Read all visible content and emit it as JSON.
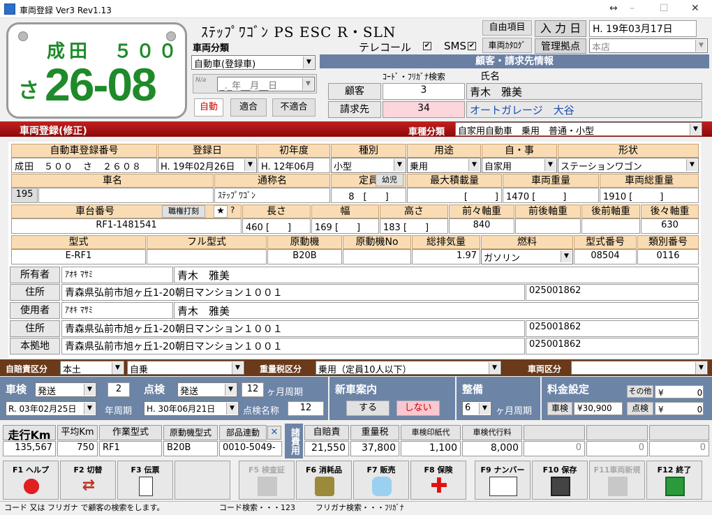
{
  "window": {
    "title": "車両登録 Ver3 Rev1.13",
    "controls": {
      "restore": "↔",
      "minimize": "–",
      "maximize": "☐",
      "close": "✕"
    }
  },
  "plate": {
    "region": "成田　５００",
    "kana": "さ",
    "number": "26-08"
  },
  "car_name": "ｽﾃｯﾌﾟﾜｺﾞﾝ PS ESC R・SLN",
  "top_buttons": {
    "free_item": "自由項目",
    "input_date_label": "入 力 日",
    "input_date": "H. 19年03月17日",
    "car_catalog": "車両ｶﾀﾛｸﾞ",
    "mgmt_base_label": "管理拠点",
    "mgmt_base": "本店"
  },
  "vehicle_class": {
    "label": "車両分類",
    "value": "自動車(登録車)",
    "date_placeholder": "_._年__月__日",
    "buttons": [
      "自動",
      "適合",
      "不適合"
    ]
  },
  "options": {
    "telecall": "テレコール",
    "telecall_mark": "✔",
    "sms": "SMS",
    "sms_mark": "✔"
  },
  "customer": {
    "header": "顧客・請求先情報",
    "col_code": "ｺｰﾄﾞ・ﾌﾘｶﾞﾅ検索",
    "col_name": "氏名",
    "rows": [
      {
        "label": "顧客",
        "code": "3",
        "name": "青木　雅美"
      },
      {
        "label": "請求先",
        "code": "34",
        "name": "オートガレージ　大谷"
      }
    ]
  },
  "section": {
    "title": "車両登録(修正)",
    "type_label": "車種分類",
    "type_value": "自家用自動車　乗用　普通・小型"
  },
  "row1": {
    "headers": [
      "自動車登録番号",
      "登録日",
      "初年度",
      "種別",
      "用途",
      "自・事",
      "形状"
    ],
    "values": [
      "成田　５００　さ　２６０８",
      "H. 19年02月26日",
      "H. 12年06月",
      "小型",
      "乗用",
      "自家用",
      "ステーションワゴン"
    ]
  },
  "row2": {
    "headers": [
      "車名",
      "通称名",
      "定員",
      "最大積載量",
      "車両重量",
      "車両総重量"
    ],
    "car_code": "195",
    "car_name": "",
    "nickname": "ｽﾃｯﾌﾟﾜｺﾞﾝ",
    "capacity": "8　[　　]",
    "child_btn": "幼児",
    "max_load": "[　　　]",
    "weight": "1470 [　　　]",
    "gross": "1910 [　　　]"
  },
  "row3": {
    "headers": [
      "車台番号",
      "長さ",
      "幅",
      "高さ",
      "前々軸重",
      "前後軸重",
      "後前軸重",
      "後々軸重"
    ],
    "btn_print": "職権打刻",
    "star": "★",
    "q": "?",
    "values": [
      "RF1-1481541",
      "460 [　　]",
      "169 [　　]",
      "183 [　　]",
      "840",
      "",
      "",
      "630"
    ]
  },
  "row4": {
    "headers": [
      "型式",
      "フル型式",
      "原動機",
      "原動機No",
      "総排気量",
      "燃料",
      "型式番号",
      "類別番号"
    ],
    "values": [
      "E-RF1",
      "",
      "B20B",
      "",
      "1.97",
      "ガソリン",
      "08504",
      "0116"
    ]
  },
  "owners": [
    {
      "label": "所有者",
      "kana": "ｱｵｷ ﾏｻﾐ",
      "name": "青木　雅美"
    },
    {
      "label": "住所",
      "addr": "青森県弘前市旭ヶ丘1-20朝日マンション１００１",
      "zip": "025001862"
    },
    {
      "label": "使用者",
      "kana": "ｱｵｷ ﾏｻﾐ",
      "name": "青木　雅美"
    },
    {
      "label": "住所",
      "addr": "青森県弘前市旭ヶ丘1-20朝日マンション１００１",
      "zip": "025001862"
    },
    {
      "label": "本拠地",
      "addr": "青森県弘前市旭ヶ丘1-20朝日マンション１００１",
      "zip": "025001862"
    }
  ],
  "insurance": {
    "jibaiseki_label": "自賠責区分",
    "jibaiseki": "本土",
    "jiso": "自乗",
    "weight_tax_label": "重量税区分",
    "weight_tax": "乗用（定員10人以下）",
    "vehicle_kubun_label": "車両区分",
    "vehicle_kubun": ""
  },
  "shaken": {
    "label": "車検",
    "method": "発送",
    "cycle": "2",
    "date": "R. 03年02月25日",
    "cycle_label": "年周期"
  },
  "tenken": {
    "label": "点検",
    "method": "発送",
    "cycle": "12",
    "cycle_label": "ヶ月周期",
    "date": "H. 30年06月21日",
    "name_label": "点検名称",
    "name": "12"
  },
  "new_car": {
    "label": "新車案内",
    "yes": "する",
    "no": "しない"
  },
  "seibi": {
    "label": "整備",
    "value": "6",
    "cycle_label": "ヶ月周期"
  },
  "fee": {
    "label": "料金設定",
    "other_label": "その他",
    "other_val": "¥　　　　0",
    "shaken_label": "車検",
    "shaken_val": "¥30,900",
    "tenken_label": "点検",
    "tenken_val": "¥　　　　0"
  },
  "mileage": {
    "headers": [
      "走行Km",
      "平均Km",
      "作業型式",
      "原動機型式",
      "部品連動"
    ],
    "values": [
      "135,567",
      "750",
      "RF1",
      "B20B",
      "0010-5049-"
    ],
    "close": "✕"
  },
  "costs": {
    "side_label": "諸費用",
    "headers": [
      "自賠責",
      "重量税",
      "車検印紙代",
      "車検代行料",
      "",
      "",
      ""
    ],
    "values": [
      "21,550",
      "37,800",
      "1,100",
      "8,000",
      "0",
      "0",
      "0"
    ]
  },
  "fkeys": [
    {
      "label": "F1 ヘルプ",
      "icon": "help-icon"
    },
    {
      "label": "F2 切替",
      "icon": "switch-icon"
    },
    {
      "label": "F3 伝票",
      "icon": "document-icon"
    },
    {
      "label": "",
      "icon": ""
    },
    {
      "label": "F5 検査証",
      "icon": "certificate-icon"
    },
    {
      "label": "F6 消耗品",
      "icon": "oilcan-icon"
    },
    {
      "label": "F7 販売",
      "icon": "car-icon"
    },
    {
      "label": "F8 保険",
      "icon": "cross-icon"
    },
    {
      "label": "F9 ナンバー",
      "icon": "plate-icon"
    },
    {
      "label": "F10 保存",
      "icon": "disk-icon"
    },
    {
      "label": "F11車両新規",
      "icon": "new-icon"
    },
    {
      "label": "F12 終了",
      "icon": "exit-icon"
    }
  ],
  "status": {
    "hint": "コード 又は フリガナ で顧客の検索をします。",
    "code": "コード検索・・・123",
    "kana": "フリガナ検索・・・ﾌﾘｶﾞﾅ"
  },
  "colors": {
    "plate_green": "#1f8a2a",
    "red_bar": "#b01515",
    "brown_bar": "#6b3a1a",
    "header_peach": "#f9dcb4"
  }
}
